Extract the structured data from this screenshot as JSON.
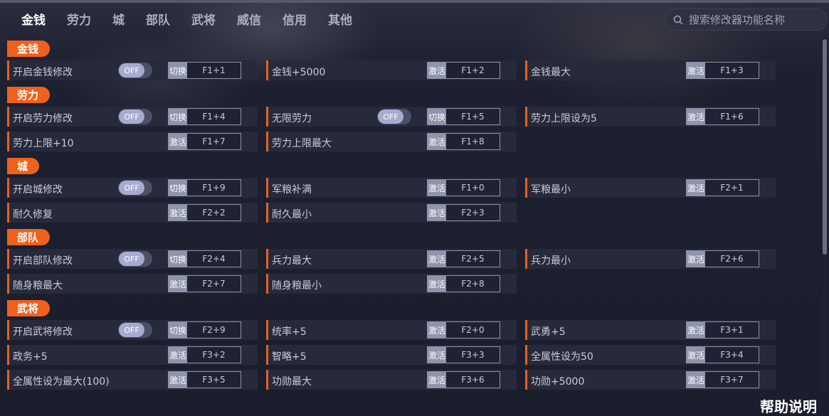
{
  "tabs": [
    {
      "label": "金钱",
      "active": true
    },
    {
      "label": "劳力",
      "active": false
    },
    {
      "label": "城",
      "active": false
    },
    {
      "label": "部队",
      "active": false
    },
    {
      "label": "武将",
      "active": false
    },
    {
      "label": "威信",
      "active": false
    },
    {
      "label": "信用",
      "active": false
    },
    {
      "label": "其他",
      "active": false
    }
  ],
  "search": {
    "placeholder": "搜索修改器功能名称",
    "icon": "search-icon"
  },
  "sections": [
    {
      "title": "金钱",
      "rows": [
        [
          {
            "label": "开启金钱修改",
            "toggle": "OFF",
            "action": "切换",
            "key": "F1+1"
          },
          {
            "label": "金钱+5000",
            "action": "激活",
            "key": "F1+2"
          },
          {
            "label": "金钱最大",
            "action": "激活",
            "key": "F1+3"
          }
        ]
      ]
    },
    {
      "title": "劳力",
      "rows": [
        [
          {
            "label": "开启劳力修改",
            "toggle": "OFF",
            "action": "切换",
            "key": "F1+4"
          },
          {
            "label": "无限劳力",
            "toggle": "OFF",
            "action": "切换",
            "key": "F1+5"
          },
          {
            "label": "劳力上限设为5",
            "action": "激活",
            "key": "F1+6"
          }
        ],
        [
          {
            "label": "劳力上限+10",
            "action": "激活",
            "key": "F1+7"
          },
          {
            "label": "劳力上限最大",
            "action": "激活",
            "key": "F1+8"
          }
        ]
      ]
    },
    {
      "title": "城",
      "rows": [
        [
          {
            "label": "开启城修改",
            "toggle": "OFF",
            "action": "切换",
            "key": "F1+9"
          },
          {
            "label": "军粮补满",
            "action": "激活",
            "key": "F1+0"
          },
          {
            "label": "军粮最小",
            "action": "激活",
            "key": "F2+1"
          }
        ],
        [
          {
            "label": "耐久修复",
            "action": "激活",
            "key": "F2+2"
          },
          {
            "label": "耐久最小",
            "action": "激活",
            "key": "F2+3"
          }
        ]
      ]
    },
    {
      "title": "部队",
      "rows": [
        [
          {
            "label": "开启部队修改",
            "toggle": "OFF",
            "action": "切换",
            "key": "F2+4"
          },
          {
            "label": "兵力最大",
            "action": "激活",
            "key": "F2+5"
          },
          {
            "label": "兵力最小",
            "action": "激活",
            "key": "F2+6"
          }
        ],
        [
          {
            "label": "随身粮最大",
            "action": "激活",
            "key": "F2+7"
          },
          {
            "label": "随身粮最小",
            "action": "激活",
            "key": "F2+8"
          }
        ]
      ]
    },
    {
      "title": "武将",
      "rows": [
        [
          {
            "label": "开启武将修改",
            "toggle": "OFF",
            "action": "切换",
            "key": "F2+9"
          },
          {
            "label": "统率+5",
            "action": "激活",
            "key": "F2+0"
          },
          {
            "label": "武勇+5",
            "action": "激活",
            "key": "F3+1"
          }
        ],
        [
          {
            "label": "政务+5",
            "action": "激活",
            "key": "F3+2"
          },
          {
            "label": "智略+5",
            "action": "激活",
            "key": "F3+3"
          },
          {
            "label": "全属性设为50",
            "action": "激活",
            "key": "F3+4"
          }
        ],
        [
          {
            "label": "全属性设为最大(100)",
            "action": "激活",
            "key": "F3+5"
          },
          {
            "label": "功勋最大",
            "action": "激活",
            "key": "F3+6"
          },
          {
            "label": "功勋+5000",
            "action": "激活",
            "key": "F3+7"
          }
        ]
      ]
    }
  ],
  "help_label": "帮助说明",
  "colors": {
    "accent": "#f0611c",
    "background": "#1b1e2d",
    "row": "#272a3b"
  }
}
